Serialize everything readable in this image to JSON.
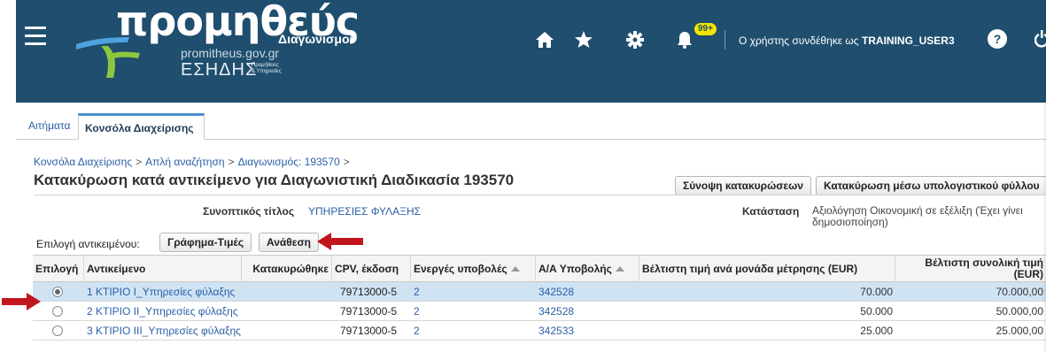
{
  "header": {
    "logo_main": "προμηθεύς",
    "logo_url": "promitheus.gov.gr",
    "logo_org": "ΕΣΗΔΗΣ",
    "logo_org_small_1": "Προμήθειες",
    "logo_org_small_2": "& Υπηρεσίες",
    "app_title": "Διαγωνισμοί",
    "notifications_badge": "99+",
    "user_prefix": "Ο χρήστης συνδέθηκε ως",
    "user_name": "TRAINING_USER3",
    "help_label": "?",
    "icons": [
      "menu-icon",
      "home-icon",
      "star-icon",
      "gear-icon",
      "bell-icon",
      "help-icon",
      "power-icon"
    ],
    "bg_color": "#1f4e6e"
  },
  "tabs": [
    {
      "label": "Αιτήματα",
      "active": false
    },
    {
      "label": "Κονσόλα Διαχείρισης",
      "active": true
    }
  ],
  "breadcrumb": [
    "Κονσόλα Διαχείρισης",
    "Απλή αναζήτηση",
    "Διαγωνισμός: 193570"
  ],
  "breadcrumb_sep": ">",
  "page_title": "Κατακύρωση κατά αντικείμενο για Διαγωνιστική Διαδικασία 193570",
  "actions": {
    "summary_label": "Σύνοψη κατακυρώσεων",
    "spreadsheet_label": "Κατακύρωση μέσω υπολογιστικού φύλλου"
  },
  "summary": {
    "title_label": "Συνοπτικός τίτλος",
    "title_value": "ΥΠΗΡΕΣΙΕΣ ΦΥΛΑΞΗΣ",
    "status_label": "Κατάσταση",
    "status_value": "Αξιολόγηση Οικονομική σε εξέλιξη (Έχει γίνει δημοσιοποίηση)"
  },
  "item_selection": {
    "label": "Επιλογή αντικειμένου:",
    "chart_button": "Γράφημα-Τιμές",
    "assign_button": "Ανάθεση"
  },
  "table": {
    "headers": {
      "select": "Επιλογή",
      "item": "Αντικείμενο",
      "awarded": "Κατακυρώθηκε",
      "cpv": "CPV, έκδοση",
      "active_bids": "Ενεργές υποβολές",
      "bid_no": "Α/Α Υποβολής",
      "best_unit_price": "Βέλτιστη τιμή ανά μονάδα μέτρησης (EUR)",
      "best_total_1": "Βέλτιστη συνολική τιμή",
      "best_total_2": "(EUR)"
    },
    "rows": [
      {
        "selected": true,
        "item": "1 ΚΤΙΡΙΟ Ι_Υπηρεσίες φύλαξης",
        "awarded": "",
        "cpv": "79713000-5",
        "active_bids": "2",
        "bid_no": "342528",
        "best_unit_price": "70.000",
        "best_total": "70.000,00"
      },
      {
        "selected": false,
        "item": "2 ΚΤΙΡΙΟ ΙΙ_Υπηρεσίες φύλαξης",
        "awarded": "",
        "cpv": "79713000-5",
        "active_bids": "2",
        "bid_no": "342528",
        "best_unit_price": "50.000",
        "best_total": "50.000,00"
      },
      {
        "selected": false,
        "item": "3 ΚΤΙΡΙΟ ΙΙΙ_Υπηρεσίες φύλαξης",
        "awarded": "",
        "cpv": "79713000-5",
        "active_bids": "2",
        "bid_no": "342533",
        "best_unit_price": "25.000",
        "best_total": "25.000,00"
      }
    ]
  },
  "colors": {
    "link": "#2a5fa5",
    "selected_row": "#cfe3f3",
    "annotation_arrow": "#c0161c",
    "badge": "#f2e500"
  }
}
